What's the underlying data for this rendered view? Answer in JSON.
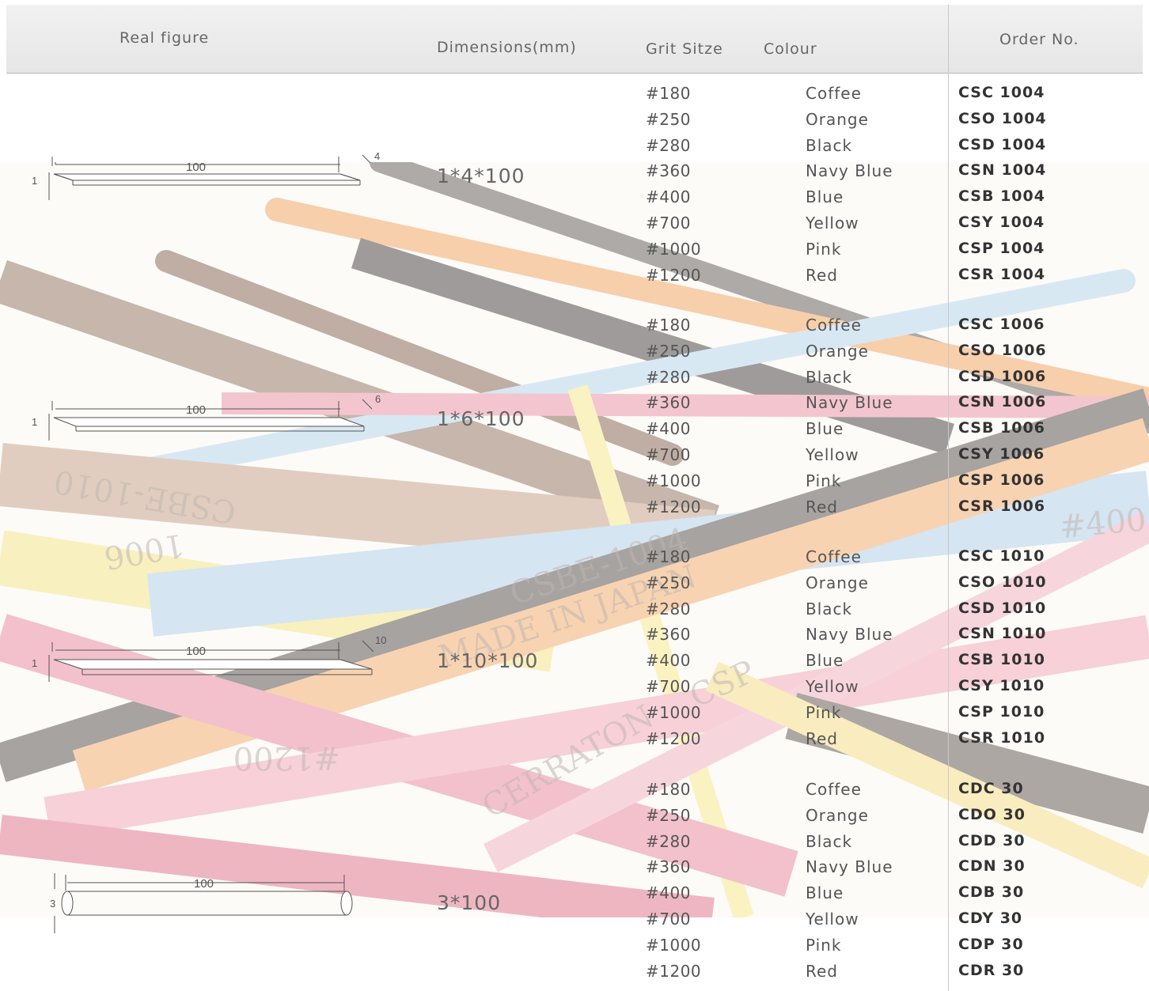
{
  "headers": {
    "real_figure": "Real figure",
    "dimensions": "Dimensions(mm)",
    "grit": "Grit Sitze",
    "colour": "Colour",
    "order": "Order No."
  },
  "groups": [
    {
      "dimension": "1*4*100",
      "figure": {
        "length": "100",
        "thickness": "1",
        "width": "4"
      },
      "rows": [
        {
          "grit": "#180",
          "colour": "Coffee",
          "order": "CSC 1004"
        },
        {
          "grit": "#250",
          "colour": "Orange",
          "order": "CSO 1004"
        },
        {
          "grit": "#280",
          "colour": "Black",
          "order": "CSD 1004"
        },
        {
          "grit": "#360",
          "colour": "Navy Blue",
          "order": "CSN 1004"
        },
        {
          "grit": "#400",
          "colour": "Blue",
          "order": "CSB 1004"
        },
        {
          "grit": "#700",
          "colour": "Yellow",
          "order": "CSY 1004"
        },
        {
          "grit": "#1000",
          "colour": "Pink",
          "order": "CSP 1004"
        },
        {
          "grit": "#1200",
          "colour": "Red",
          "order": "CSR 1004"
        }
      ]
    },
    {
      "dimension": "1*6*100",
      "figure": {
        "length": "100",
        "thickness": "1",
        "width": "6"
      },
      "rows": [
        {
          "grit": "#180",
          "colour": "Coffee",
          "order": "CSC 1006"
        },
        {
          "grit": "#250",
          "colour": "Orange",
          "order": "CSO 1006"
        },
        {
          "grit": "#280",
          "colour": "Black",
          "order": "CSD 1006"
        },
        {
          "grit": "#360",
          "colour": "Navy Blue",
          "order": "CSN 1006"
        },
        {
          "grit": "#400",
          "colour": "Blue",
          "order": "CSB 1006"
        },
        {
          "grit": "#700",
          "colour": "Yellow",
          "order": "CSY 1006"
        },
        {
          "grit": "#1000",
          "colour": "Pink",
          "order": "CSP 1006"
        },
        {
          "grit": "#1200",
          "colour": "Red",
          "order": "CSR 1006"
        }
      ]
    },
    {
      "dimension": "1*10*100",
      "figure": {
        "length": "100",
        "thickness": "1",
        "width": "10"
      },
      "rows": [
        {
          "grit": "#180",
          "colour": "Coffee",
          "order": "CSC 1010"
        },
        {
          "grit": "#250",
          "colour": "Orange",
          "order": "CSO 1010"
        },
        {
          "grit": "#280",
          "colour": "Black",
          "order": "CSD 1010"
        },
        {
          "grit": "#360",
          "colour": "Navy Blue",
          "order": "CSN 1010"
        },
        {
          "grit": "#400",
          "colour": "Blue",
          "order": "CSB 1010"
        },
        {
          "grit": "#700",
          "colour": "Yellow",
          "order": "CSY 1010"
        },
        {
          "grit": "#1000",
          "colour": "Pink",
          "order": "CSP 1010"
        },
        {
          "grit": "#1200",
          "colour": "Red",
          "order": "CSR 1010"
        }
      ]
    },
    {
      "dimension": "3*100",
      "figure": {
        "length": "100",
        "thickness": "3"
      },
      "rows": [
        {
          "grit": "#180",
          "colour": "Coffee",
          "order": "CDC 30"
        },
        {
          "grit": "#250",
          "colour": "Orange",
          "order": "CDO 30"
        },
        {
          "grit": "#280",
          "colour": "Black",
          "order": "CDD 30"
        },
        {
          "grit": "#360",
          "colour": "Navy Blue",
          "order": "CDN 30"
        },
        {
          "grit": "#400",
          "colour": "Blue",
          "order": "CDB 30"
        },
        {
          "grit": "#700",
          "colour": "Yellow",
          "order": "CDY 30"
        },
        {
          "grit": "#1000",
          "colour": "Pink",
          "order": "CDP 30"
        },
        {
          "grit": "#1200",
          "colour": "Red",
          "order": "CDR 30"
        }
      ]
    }
  ],
  "background_photo": {
    "stick_colors": [
      "#e8a463",
      "#f2cc8a",
      "#8a6a55",
      "#5e5450",
      "#e8879a",
      "#aecde4",
      "#f5e58c",
      "#d9b99a"
    ],
    "stick_labels": [
      "CSBE-1004",
      "MADE IN JAPAN",
      "CERRATON",
      "#1200",
      "CSP",
      "1006",
      "#400",
      "CSBE-1010"
    ]
  }
}
